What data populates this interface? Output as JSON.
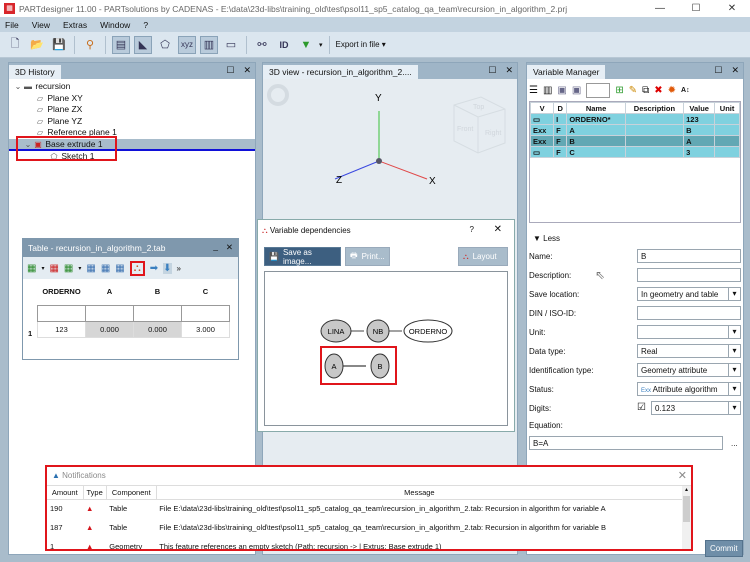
{
  "window": {
    "title": "PARTdesigner 11.00 - PARTsolutions by CADENAS - E:\\data\\23d-libs\\training_old\\test\\psol11_sp5_catalog_qa_team\\recursion_in_algorithm_2.prj",
    "minimize": "—",
    "maximize": "☐",
    "close": "✕"
  },
  "menu": [
    "File",
    "View",
    "Extras",
    "Window",
    "?"
  ],
  "toolbar": {
    "export_label": "Export in file"
  },
  "history": {
    "tab": "3D History",
    "items": [
      {
        "label": "recursion",
        "icon": "folder-icon"
      },
      {
        "label": "Plane XY",
        "icon": "plane-icon"
      },
      {
        "label": "Plane ZX",
        "icon": "plane-icon"
      },
      {
        "label": "Plane YZ",
        "icon": "plane-icon"
      },
      {
        "label": "Reference plane 1",
        "icon": "plane-icon"
      },
      {
        "label": "Base extrude 1",
        "icon": "extrude-icon"
      },
      {
        "label": "Sketch 1",
        "icon": "sketch-icon"
      }
    ]
  },
  "view3d": {
    "tab": "3D view - recursion_in_algorithm_2....",
    "axes": {
      "x": "X",
      "y": "Y",
      "z": "Z"
    },
    "cube": {
      "top": "Top",
      "front": "Front",
      "right": "Right"
    }
  },
  "table_window": {
    "title": "Table - recursion_in_algorithm_2.tab",
    "columns": [
      "ORDERNO",
      "A",
      "B",
      "C"
    ],
    "rows": [
      {
        "num": "1",
        "cells": [
          "123",
          "0.000",
          "0.000",
          "3.000"
        ]
      }
    ]
  },
  "dependencies": {
    "title": "Variable dependencies",
    "help": "?",
    "save": "Save as image...",
    "print": "Print...",
    "layout": "Layout",
    "nodes": {
      "lina": "LINA",
      "nb": "NB",
      "orderno": "ORDERNO",
      "a": "A",
      "b": "B"
    }
  },
  "varman": {
    "tab": "Variable Manager",
    "columns": [
      "V",
      "D",
      "Name",
      "Description",
      "Value",
      "Unit"
    ],
    "rows": [
      {
        "v": "▭",
        "d": "I",
        "name": "ORDERNO*",
        "desc": "",
        "value": "123",
        "unit": ""
      },
      {
        "v": "Exx",
        "d": "F",
        "name": "A",
        "desc": "",
        "value": "B",
        "unit": ""
      },
      {
        "v": "Exx",
        "d": "F",
        "name": "B",
        "desc": "",
        "value": "A",
        "unit": ""
      },
      {
        "v": "▭",
        "d": "F",
        "name": "C",
        "desc": "",
        "value": "3",
        "unit": ""
      }
    ],
    "less": "Less",
    "form": {
      "name_l": "Name:",
      "name": "B",
      "desc_l": "Description:",
      "desc": "",
      "save_l": "Save location:",
      "save": "In geometry and table",
      "din_l": "DIN / ISO-ID:",
      "din": "",
      "unit_l": "Unit:",
      "unit": "",
      "dtype_l": "Data type:",
      "dtype": "Real",
      "idtype_l": "Identification type:",
      "idtype": "Geometry attribute",
      "status_l": "Status:",
      "status": "Attribute algorithm",
      "digits_l": "Digits:",
      "digits": "0.123",
      "eq_l": "Equation:",
      "eq": "B=A",
      "more": "..."
    },
    "commit": "Commit"
  },
  "notifications": {
    "title": "Notifications",
    "columns": [
      "Amount",
      "Type",
      "Component",
      "Message"
    ],
    "rows": [
      {
        "amount": "190",
        "component": "Table",
        "message": "File E:\\data\\23d-libs\\training_old\\test\\psol11_sp5_catalog_qa_team\\recursion_in_algorithm_2.tab: Recursion in algorithm for variable A"
      },
      {
        "amount": "187",
        "component": "Table",
        "message": "File E:\\data\\23d-libs\\training_old\\test\\psol11_sp5_catalog_qa_team\\recursion_in_algorithm_2.tab: Recursion in algorithm for variable B"
      },
      {
        "amount": "1",
        "component": "Geometry",
        "message": "This feature references an empty sketch (Path: recursion -> | Extrus: Base extrude 1)"
      }
    ]
  }
}
